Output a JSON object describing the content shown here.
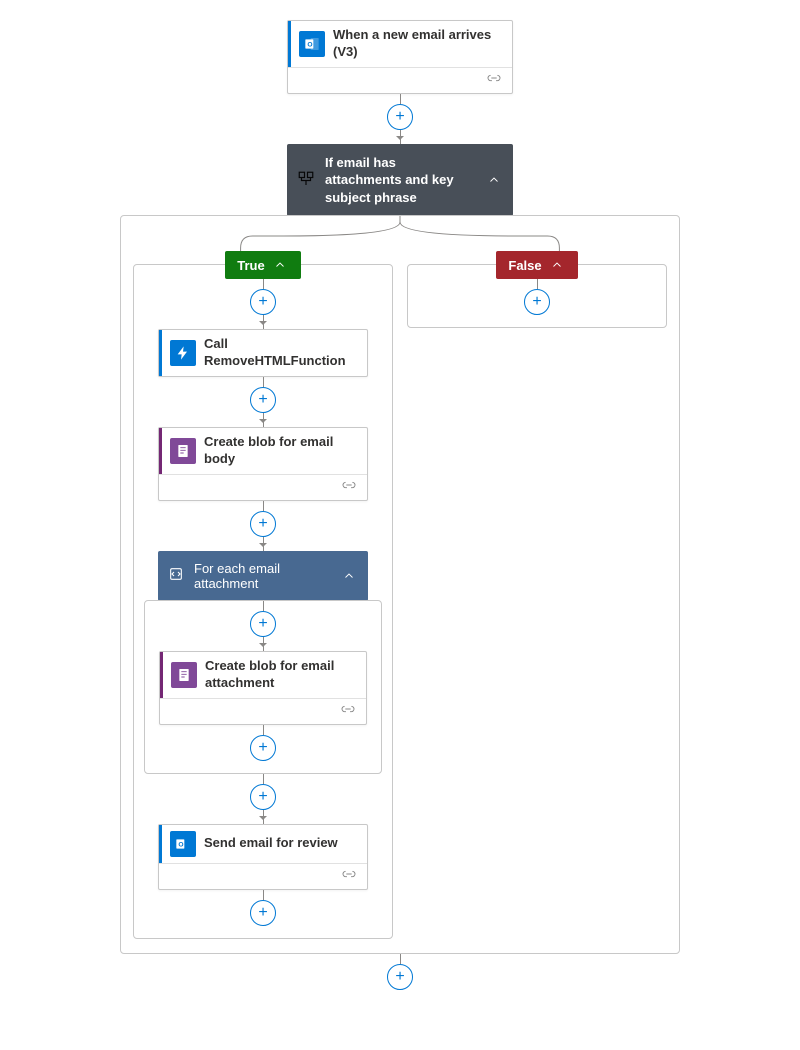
{
  "trigger": {
    "title": "When a new email arrives (V3)"
  },
  "condition": {
    "title": "If email has attachments and key subject phrase"
  },
  "badges": {
    "true": "True",
    "false": "False"
  },
  "actions": {
    "call_fn": "Call RemoveHTMLFunction",
    "blob_body": "Create blob for email body",
    "loop": "For each email attachment",
    "blob_att": "Create blob for email attachment",
    "send": "Send email for review"
  }
}
